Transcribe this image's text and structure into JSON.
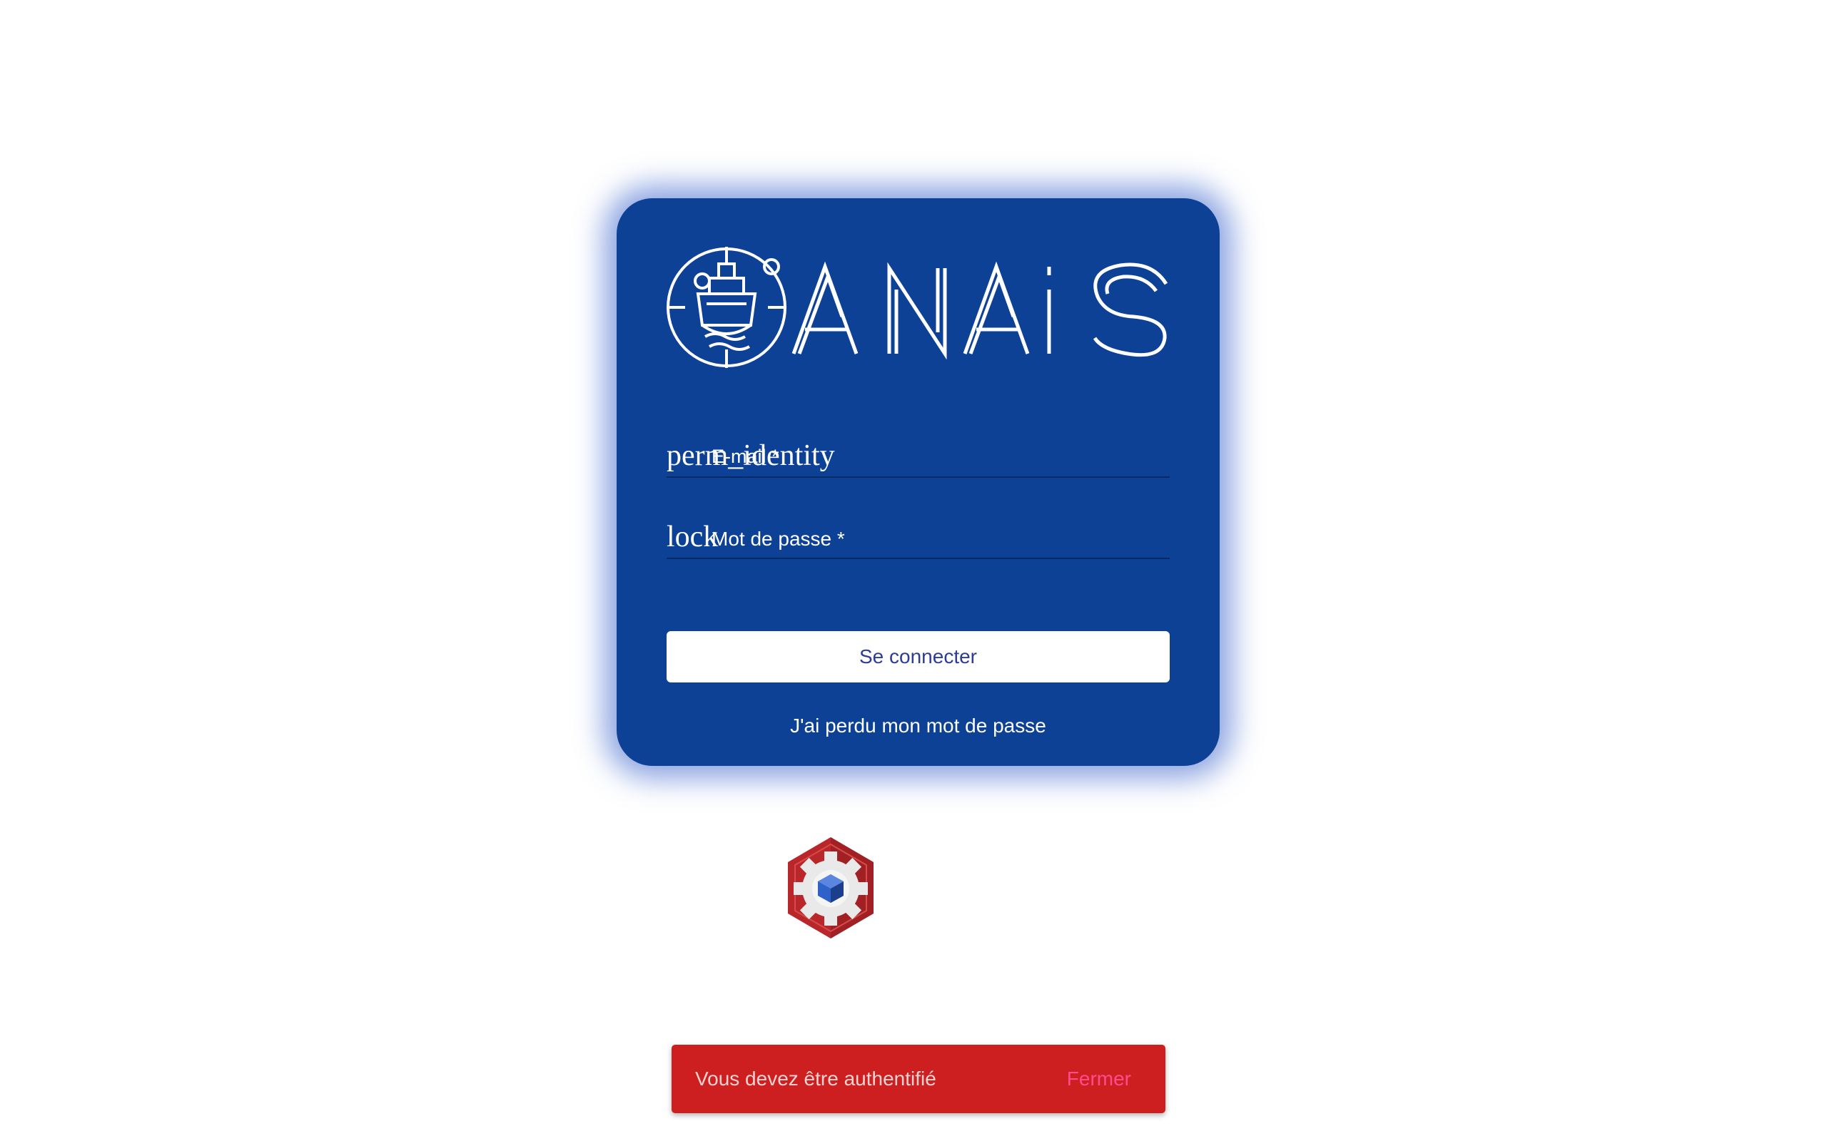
{
  "brand": {
    "name": "ANAIS",
    "logo_icon": "ship-radar-icon"
  },
  "login_form": {
    "email_field": {
      "icon_ligature": "perm_identity",
      "label": "E-mail *",
      "value": ""
    },
    "password_field": {
      "icon_ligature": "lock",
      "label": "Mot de passe *",
      "value": ""
    },
    "submit_label": "Se connecter",
    "forgot_password_label": "J'ai perdu mon mot de passe"
  },
  "app_icon": {
    "name": "gear-cube-icon"
  },
  "snackbar": {
    "message": "Vous devez être authentifié",
    "action_label": "Fermer"
  },
  "colors": {
    "card_background": "#0d4196",
    "button_text": "#2d3c97",
    "snackbar_background": "#cd1f1f",
    "snackbar_action": "#ff4c8f"
  }
}
